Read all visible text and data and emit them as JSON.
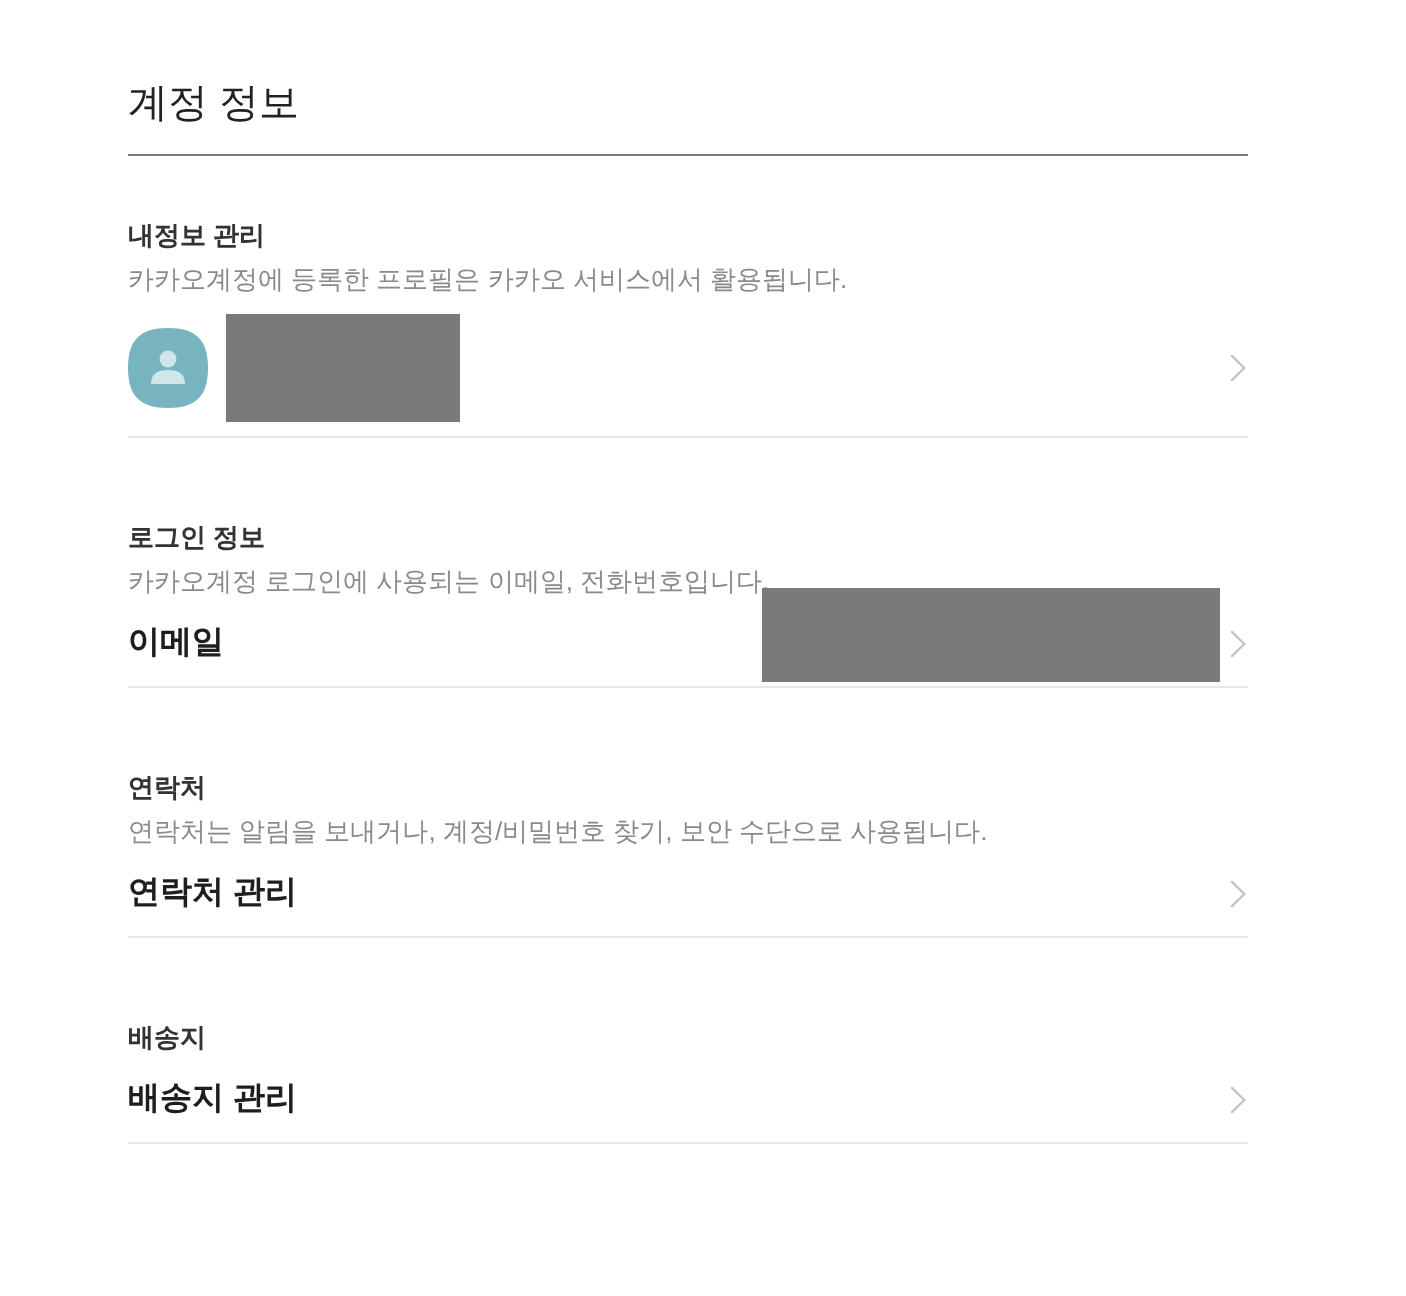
{
  "page": {
    "title": "계정 정보"
  },
  "sections": [
    {
      "heading": "내정보 관리",
      "description": "카카오계정에 등록한 프로필은 카카오 서비스에서 활용됩니다.",
      "row": {
        "kind": "profile",
        "redacted": true
      }
    },
    {
      "heading": "로그인 정보",
      "description": "카카오계정 로그인에 사용되는 이메일, 전화번호입니다.",
      "row": {
        "kind": "entry",
        "label": "이메일",
        "redacted": true
      }
    },
    {
      "heading": "연락처",
      "description": "연락처는 알림을 보내거나, 계정/비밀번호 찾기, 보안 수단으로 사용됩니다.",
      "row": {
        "kind": "entry",
        "label": "연락처 관리"
      }
    },
    {
      "heading": "배송지",
      "row": {
        "kind": "entry",
        "label": "배송지 관리"
      }
    }
  ]
}
